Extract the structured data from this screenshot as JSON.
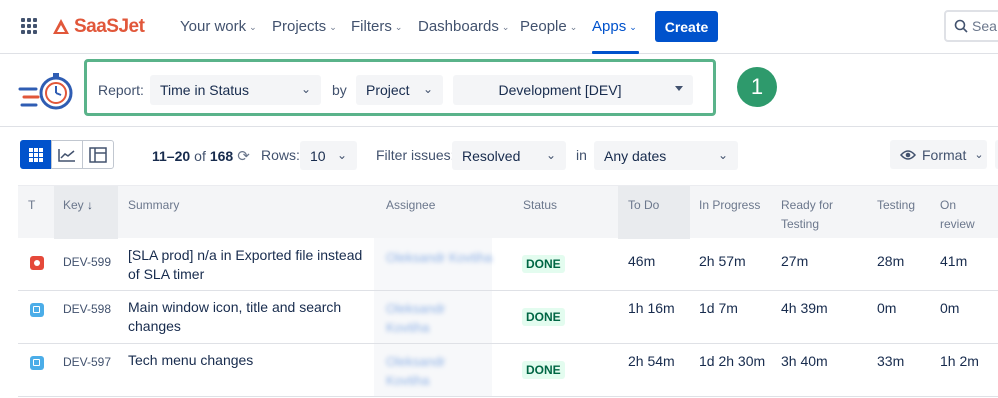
{
  "nav": {
    "logo": "SaaSJet",
    "items": [
      {
        "label": "Your work"
      },
      {
        "label": "Projects"
      },
      {
        "label": "Filters"
      },
      {
        "label": "Dashboards"
      },
      {
        "label": "People"
      },
      {
        "label": "Apps"
      }
    ],
    "active_item": "Apps",
    "create_label": "Create",
    "search_placeholder": "Sea"
  },
  "report": {
    "report_label": "Report:",
    "report_value": "Time in Status",
    "by_label": "by",
    "by_value": "Project",
    "project_value": "Development [DEV]",
    "callout_number": "1"
  },
  "toolbar": {
    "range": "11–20",
    "of_label": "of",
    "total": "168",
    "rows_label": "Rows:",
    "rows_value": "10",
    "filter_label": "Filter issues:",
    "filter_value": "Resolved",
    "in_label": "in",
    "dates_value": "Any dates",
    "format_label": "Format"
  },
  "table": {
    "headers": {
      "type": "T",
      "key": "Key",
      "summary": "Summary",
      "assignee": "Assignee",
      "status": "Status",
      "todo": "To Do",
      "inprogress": "In Progress",
      "ready1": "Ready for",
      "ready2": "Testing",
      "testing": "Testing",
      "onreview1": "On",
      "onreview2": "review"
    },
    "rows": [
      {
        "type": "bug",
        "key": "DEV-599",
        "summary1": "[SLA prod] n/a in Exported file instead",
        "summary2": "of SLA timer",
        "assignee1": "Oleksandr Kovtiha",
        "assignee2": "",
        "status": "DONE",
        "todo": "46m",
        "inprogress": "2h 57m",
        "ready": "27m",
        "testing": "28m",
        "onreview": "41m"
      },
      {
        "type": "task",
        "key": "DEV-598",
        "summary1": "Main window icon, title and search",
        "summary2": "changes",
        "assignee1": "Oleksandr",
        "assignee2": "Kovtiha",
        "status": "DONE",
        "todo": "1h 16m",
        "inprogress": "1d 7m",
        "ready": "4h 39m",
        "testing": "0m",
        "onreview": "0m"
      },
      {
        "type": "task",
        "key": "DEV-597",
        "summary1": "Tech menu changes",
        "summary2": "",
        "assignee1": "Oleksandr",
        "assignee2": "Kovtiha",
        "status": "DONE",
        "todo": "2h 54m",
        "inprogress": "1d 2h 30m",
        "ready": "3h 40m",
        "testing": "33m",
        "onreview": "1h 2m"
      }
    ]
  },
  "colors": {
    "accent": "#0052cc",
    "brand": "#e1573a",
    "highlight": "#5ab38a",
    "callout": "#2e9a6c",
    "done_bg": "#e3fcef",
    "done_text": "#006644"
  }
}
